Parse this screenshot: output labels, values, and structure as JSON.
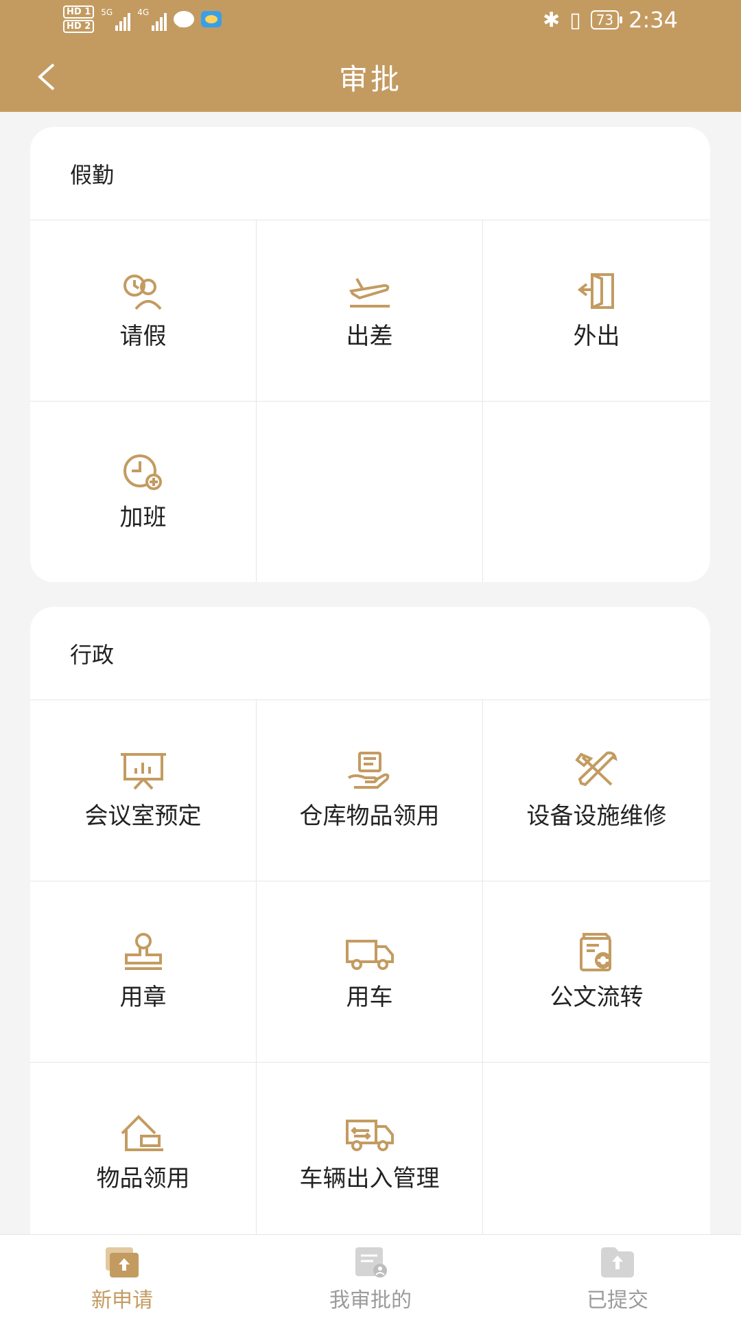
{
  "status_bar": {
    "hd1": "HD",
    "hd1_sub": "1",
    "hd2": "HD",
    "hd2_sub": "2",
    "net1": "5G",
    "net2": "4G",
    "battery": "73",
    "time": "2:34"
  },
  "header": {
    "title": "审批"
  },
  "sections": [
    {
      "title": "假勤",
      "items": [
        {
          "label": "请假",
          "icon": "leave-icon"
        },
        {
          "label": "出差",
          "icon": "airplane-icon"
        },
        {
          "label": "外出",
          "icon": "door-exit-icon"
        },
        {
          "label": "加班",
          "icon": "clock-plus-icon"
        }
      ]
    },
    {
      "title": "行政",
      "items": [
        {
          "label": "会议室预定",
          "icon": "presentation-board-icon"
        },
        {
          "label": "仓库物品领用",
          "icon": "hand-receive-icon"
        },
        {
          "label": "设备设施维修",
          "icon": "tools-icon"
        },
        {
          "label": "用章",
          "icon": "stamp-icon"
        },
        {
          "label": "用车",
          "icon": "truck-icon"
        },
        {
          "label": "公文流转",
          "icon": "document-refresh-icon"
        },
        {
          "label": "物品领用",
          "icon": "house-box-icon"
        },
        {
          "label": "车辆出入管理",
          "icon": "truck-arrows-icon"
        }
      ]
    }
  ],
  "tabbar": {
    "tabs": [
      {
        "label": "新申请",
        "icon": "new-request-icon",
        "active": true
      },
      {
        "label": "我审批的",
        "icon": "my-approvals-icon",
        "active": false
      },
      {
        "label": "已提交",
        "icon": "submitted-icon",
        "active": false
      }
    ]
  },
  "colors": {
    "accent": "#c39b61",
    "background": "#f4f4f4"
  }
}
